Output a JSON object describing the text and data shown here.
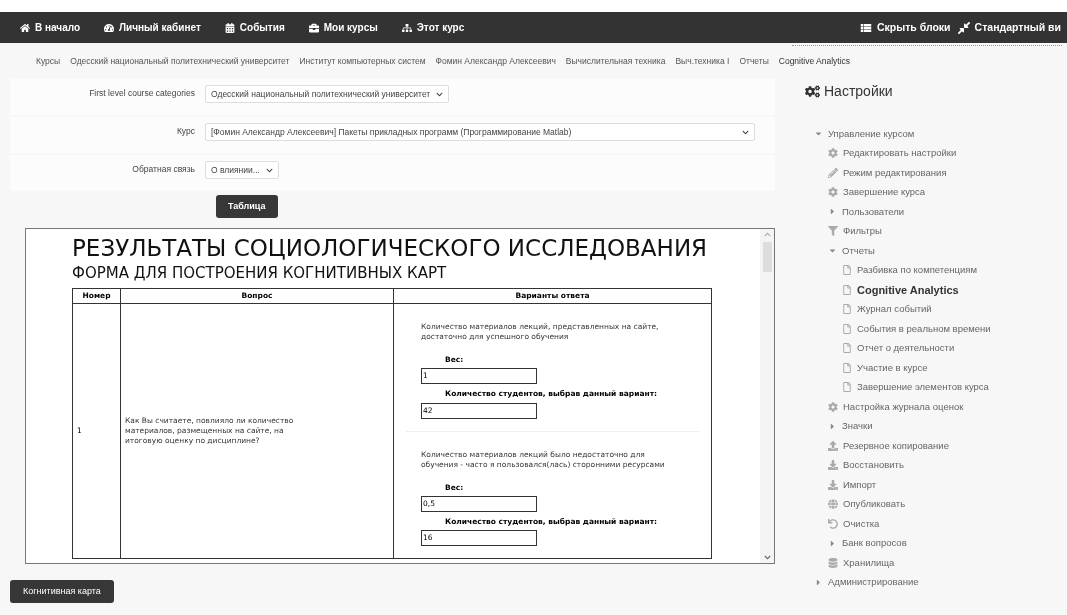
{
  "navbar": {
    "items": [
      {
        "label": "В начало",
        "kind": "home"
      },
      {
        "label": "Личный кабинет",
        "kind": "dashboard"
      },
      {
        "label": "События",
        "kind": "calendar"
      },
      {
        "label": "Мои курсы",
        "kind": "briefcase"
      },
      {
        "label": "Этот курс",
        "kind": "sitemap"
      }
    ],
    "right": [
      {
        "label": "Скрыть блоки",
        "kind": "blocks"
      },
      {
        "label": "Стандартный ви",
        "kind": "expand"
      }
    ]
  },
  "breadcrumb": [
    "Курсы",
    "Одесский национальный политехнический университет",
    "Институт компьютерных систем",
    "Фомин Александр Алексеевич",
    "Вычислительная техника",
    "Выч.техника I",
    "Отчеты",
    "Cognitive Analytics"
  ],
  "form": {
    "fields": [
      {
        "label": "First level course categories",
        "value": "Одесский национальный политехнический университет",
        "wide": false
      },
      {
        "label": "Курс",
        "value": "[Фомин Александр Алексеевич] Пакеты прикладных программ (Программирование Matlab)",
        "wide": true
      },
      {
        "label": "Обратная связь",
        "value": "О влиянии...",
        "wide": false
      }
    ],
    "submit": "Таблица"
  },
  "report": {
    "title": "РЕЗУЛЬТАТЫ СОЦИОЛОГИЧЕСКОГО ИССЛЕДОВАНИЯ",
    "subtitle": "ФОРМА ДЛЯ ПОСТРОЕНИЯ КОГНИТИВНЫХ КАРТ",
    "columns": [
      "Номер",
      "Вопрос",
      "Варианты ответа"
    ],
    "rows": [
      {
        "number": "1",
        "question": "Как Вы считаете, повлияло ли количество материалов, размещенных на сайте, на итоговую оценку по дисциплине?",
        "answers": [
          {
            "text": "Количество материалов лекций, представленных на сайте, достаточно для успешного обучения",
            "weight_label": "Вес:",
            "weight": "1",
            "count_label": "Количество студентов, выбрав данный вариант:",
            "count": "42"
          },
          {
            "text": "Количество материалов лекций было недостаточно для обучения - часто я пользовался(лась) сторонними ресурсами",
            "weight_label": "Вес:",
            "weight": "0,5",
            "count_label": "Количество студентов, выбрав данный вариант:",
            "count": "16"
          }
        ]
      }
    ]
  },
  "map_button": "Когнитивная карта",
  "settings": {
    "title": "Настройки",
    "items": [
      {
        "label": "Управление курсом",
        "kind": "branch",
        "expanded": true,
        "selected": false,
        "children": [
          {
            "label": "Редактировать настройки",
            "kind": "gear",
            "selected": false
          },
          {
            "label": "Режим редактирования",
            "kind": "pencil",
            "selected": false
          },
          {
            "label": "Завершение курса",
            "kind": "gear",
            "selected": false
          },
          {
            "label": "Пользователи",
            "kind": "branch",
            "expanded": false,
            "selected": false
          },
          {
            "label": "Фильтры",
            "kind": "filter",
            "selected": false
          },
          {
            "label": "Отчеты",
            "kind": "branch",
            "expanded": true,
            "selected": false,
            "children": [
              {
                "label": "Разбивка по компетенциям",
                "kind": "page",
                "selected": false
              },
              {
                "label": "Cognitive Analytics",
                "kind": "page",
                "selected": true
              },
              {
                "label": "Журнал событий",
                "kind": "page",
                "selected": false
              },
              {
                "label": "События в реальном времени",
                "kind": "page",
                "selected": false
              },
              {
                "label": "Отчет о деятельности",
                "kind": "page",
                "selected": false
              },
              {
                "label": "Участие в курсе",
                "kind": "page",
                "selected": false
              },
              {
                "label": "Завершение элементов курса",
                "kind": "page",
                "selected": false
              }
            ]
          },
          {
            "label": "Настройка журнала оценок",
            "kind": "gear",
            "selected": false
          },
          {
            "label": "Значки",
            "kind": "branch",
            "expanded": false,
            "selected": false
          },
          {
            "label": "Резервное копирование",
            "kind": "upload",
            "selected": false
          },
          {
            "label": "Восстановить",
            "kind": "download",
            "selected": false
          },
          {
            "label": "Импорт",
            "kind": "download",
            "selected": false
          },
          {
            "label": "Опубликовать",
            "kind": "globe",
            "selected": false
          },
          {
            "label": "Очистка",
            "kind": "reset",
            "selected": false
          },
          {
            "label": "Банк вопросов",
            "kind": "branch",
            "expanded": false,
            "selected": false
          },
          {
            "label": "Хранилища",
            "kind": "storage",
            "selected": false
          }
        ]
      },
      {
        "label": "Администрирование",
        "kind": "branch",
        "expanded": false,
        "selected": false
      }
    ]
  }
}
